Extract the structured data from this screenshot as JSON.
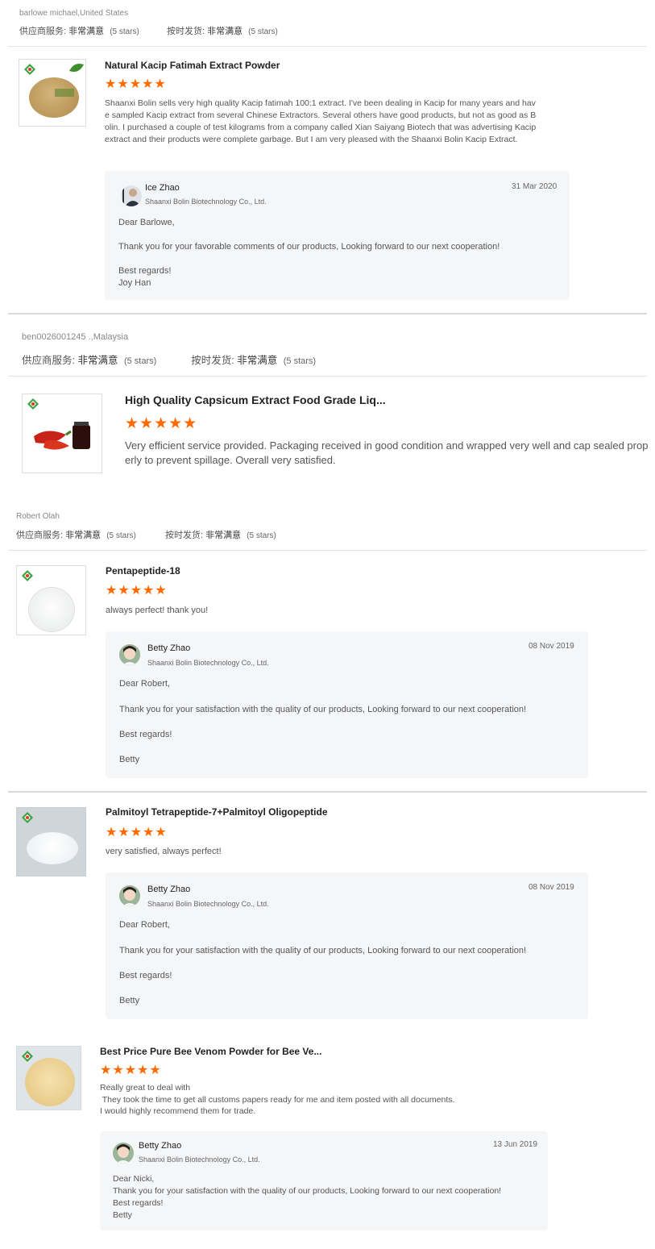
{
  "labels": {
    "service": "供应商服务:",
    "delivery": "按时发货:",
    "very_satisfied": "非常满意",
    "five_stars": "(5 stars)",
    "stars_glyph": "★★★★★"
  },
  "reviews": [
    {
      "reviewer": "barlowe michael,United States",
      "items": [
        {
          "product": "Natural Kacip Fatimah Extract Powder",
          "text": "Shaanxi Bolin sells very high quality Kacip fatimah 100:1 extract. I've been dealing in Kacip for many years and have sampled Kacip extract from several Chinese Extractors. Several others have good products, but not as good as Bolin. I purchased a couple of test kilograms from a company called Xian Saiyang Biotech that was advertising Kacip extract and their products were complete garbage. But I am very pleased with the Shaanxi Bolin Kacip Extract.",
          "reply": {
            "name": "Ice Zhao",
            "company": "Shaanxi Bolin Biotechnology Co., Ltd.",
            "date": "31 Mar 2020",
            "lines": [
              "Dear Barlowe,",
              "Thank you for your favorable comments of our products, Looking forward to our next cooperation!",
              "Best regards!",
              "Joy Han"
            ]
          }
        }
      ]
    },
    {
      "reviewer": "ben0026001245 .,Malaysia",
      "items": [
        {
          "product": "High Quality Capsicum Extract Food Grade Liq...",
          "text": "Very efficient service provided. Packaging received in good condition and wrapped very well and cap sealed properly to prevent spillage. Overall very satisfied."
        }
      ]
    },
    {
      "reviewer": "Robert Olah",
      "items": [
        {
          "product": "Pentapeptide-18",
          "text": "always perfect! thank you!",
          "reply": {
            "name": "Betty Zhao",
            "company": "Shaanxi Bolin Biotechnology Co., Ltd.",
            "date": "08 Nov 2019",
            "lines": [
              "Dear Robert,",
              "Thank you for your satisfaction with the quality of our products, Looking forward to our next cooperation!",
              "Best regards!",
              "Betty"
            ]
          }
        },
        {
          "product": "Palmitoyl Tetrapeptide-7+Palmitoyl Oligopeptide",
          "text": "very satisfied, always perfect!",
          "reply": {
            "name": "Betty Zhao",
            "company": "Shaanxi Bolin Biotechnology Co., Ltd.",
            "date": "08 Nov 2019",
            "lines": [
              "Dear Robert,",
              "Thank you for your satisfaction with the quality of our products, Looking forward to our next cooperation!",
              "Best regards!",
              "Betty"
            ]
          }
        },
        {
          "product": "Best Price Pure Bee Venom Powder for Bee Ve...",
          "text_lines": [
            "Really great to deal with",
            " They took the time to get all customs papers ready for me and item posted with all documents.",
            "I would highly recommend them for trade."
          ],
          "reply": {
            "name": "Betty Zhao",
            "company": "Shaanxi Bolin Biotechnology Co., Ltd.",
            "date": "13 Jun 2019",
            "lines": [
              "Dear Nicki,",
              "Thank you for your satisfaction with the quality of our products, Looking forward to our next cooperation!",
              "Best regards!",
              "Betty"
            ]
          }
        }
      ]
    }
  ]
}
